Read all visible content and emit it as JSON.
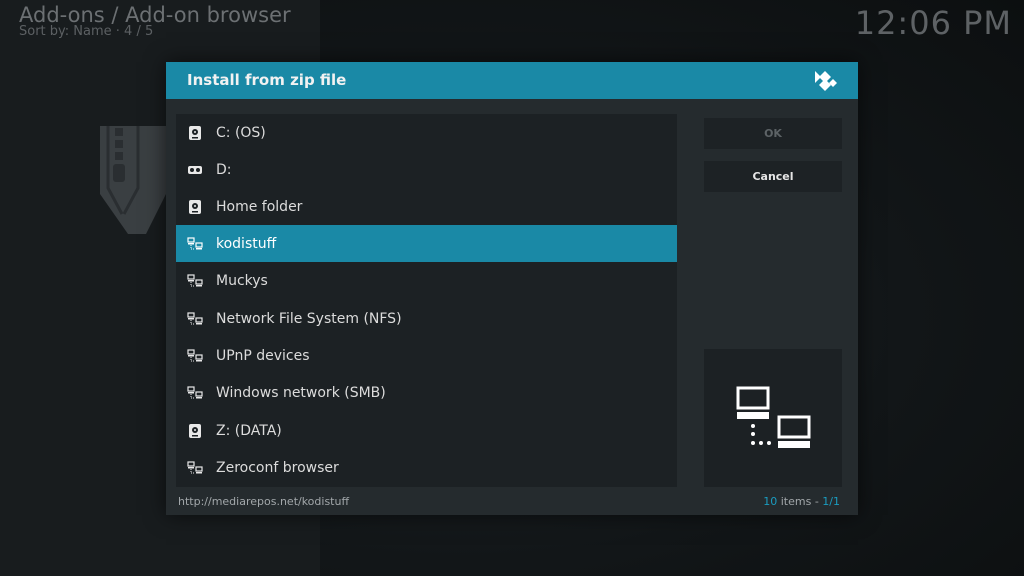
{
  "header": {
    "breadcrumb": "Add-ons  / Add-on browser",
    "sort_info": "Sort by: Name  ·  4 / 5",
    "clock": "12:06 PM"
  },
  "dialog": {
    "title": "Install from zip file",
    "items": [
      {
        "label": "C: (OS)",
        "icon": "hard-drive-icon",
        "selected": false
      },
      {
        "label": "D:",
        "icon": "optical-drive-icon",
        "selected": false
      },
      {
        "label": "Home folder",
        "icon": "hard-drive-icon",
        "selected": false
      },
      {
        "label": "kodistuff",
        "icon": "network-icon",
        "selected": true
      },
      {
        "label": "Muckys",
        "icon": "network-icon",
        "selected": false
      },
      {
        "label": "Network File System (NFS)",
        "icon": "network-icon",
        "selected": false
      },
      {
        "label": "UPnP devices",
        "icon": "network-icon",
        "selected": false
      },
      {
        "label": "Windows network (SMB)",
        "icon": "network-icon",
        "selected": false
      },
      {
        "label": "Z: (DATA)",
        "icon": "hard-drive-icon",
        "selected": false
      },
      {
        "label": "Zeroconf browser",
        "icon": "network-icon",
        "selected": false
      }
    ],
    "buttons": {
      "ok_label": "OK",
      "cancel_label": "Cancel"
    },
    "footer": {
      "path": "http://mediarepos.net/kodistuff",
      "count_number": "10",
      "count_word": " items - ",
      "page": "1/1"
    },
    "preview_icon": "network-computers-icon"
  },
  "colors": {
    "accent": "#1a89a6",
    "dialog_bg": "#252b2e",
    "list_bg": "#1c2124"
  }
}
